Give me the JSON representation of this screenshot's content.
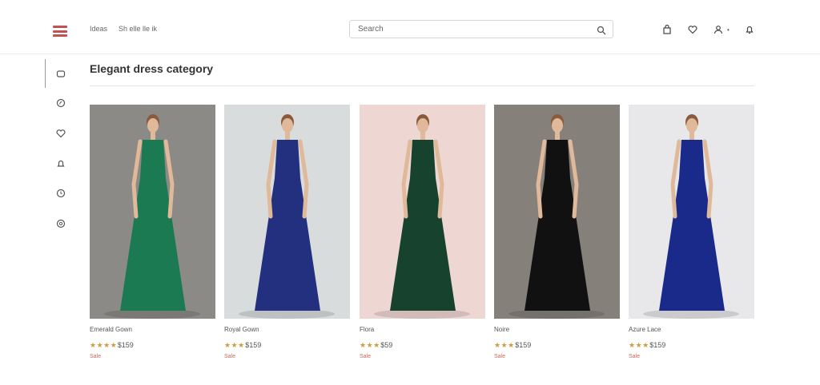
{
  "header": {
    "nav_links": [
      "Ideas",
      "Sh elle lle ik"
    ],
    "search": {
      "placeholder": "Search"
    },
    "action_icons": [
      "bag-icon",
      "heart-icon",
      "user-icon",
      "bell-icon"
    ]
  },
  "sidebar": {
    "items": [
      {
        "icon": "chat-icon"
      },
      {
        "icon": "explore-icon"
      },
      {
        "icon": "heart-icon"
      },
      {
        "icon": "bell-icon"
      },
      {
        "icon": "clock-icon"
      },
      {
        "icon": "settings-icon"
      }
    ]
  },
  "main": {
    "title": "Elegant dress category"
  },
  "products": [
    {
      "name": "Emerald Gown",
      "stars": "★ ★ ★ ★",
      "price": "$159",
      "sale": "Sale",
      "colors": {
        "bg": "#8c8a86",
        "dress": "#1c7a52"
      }
    },
    {
      "name": "Royal Gown",
      "stars": "★ ★ ★",
      "price": "$159",
      "sale": "Sale",
      "colors": {
        "bg": "#d9dcdd",
        "dress": "#23307f"
      }
    },
    {
      "name": "Flora",
      "stars": "★ ★ ★",
      "price": "$59",
      "sale": "Sale",
      "colors": {
        "bg": "#eed6d3",
        "dress": "#17432e"
      }
    },
    {
      "name": "Noire",
      "stars": "★ ★ ★",
      "price": "$159",
      "sale": "Sale",
      "colors": {
        "bg": "#85807a",
        "dress": "#111111"
      }
    },
    {
      "name": "Azure Lace",
      "stars": "★ ★ ★",
      "price": "$159",
      "sale": "Sale",
      "colors": {
        "bg": "#e8e8ea",
        "dress": "#1a2a8a"
      }
    }
  ]
}
